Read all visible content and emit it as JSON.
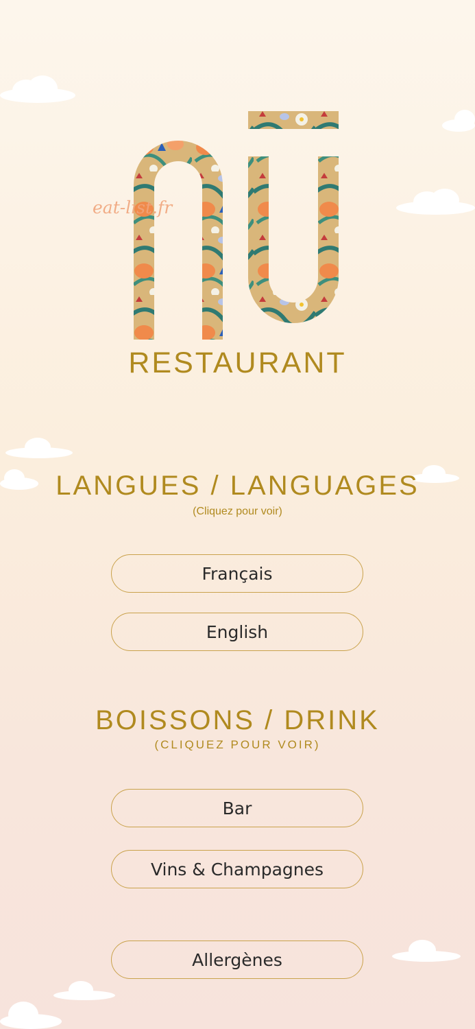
{
  "brand": {
    "name": "RESTAURANT",
    "watermark": "eat-list.fr",
    "logo_icon": "nu-floral-logo"
  },
  "languages": {
    "title": "LANGUES  /  LANGUAGES",
    "subtitle": "(Cliquez pour voir)",
    "buttons": [
      {
        "label": "Français"
      },
      {
        "label": "English"
      }
    ]
  },
  "drinks": {
    "title": "BOISSONS  /  DRINK",
    "subtitle": "(CLIQUEZ POUR VOIR)",
    "buttons": [
      {
        "label": "Bar"
      },
      {
        "label": "Vins & Champagnes"
      }
    ]
  },
  "allergens": {
    "label": "Allergènes"
  },
  "colors": {
    "accent": "#b08a1f",
    "border": "#c9a24b",
    "text": "#2a2a2a"
  }
}
